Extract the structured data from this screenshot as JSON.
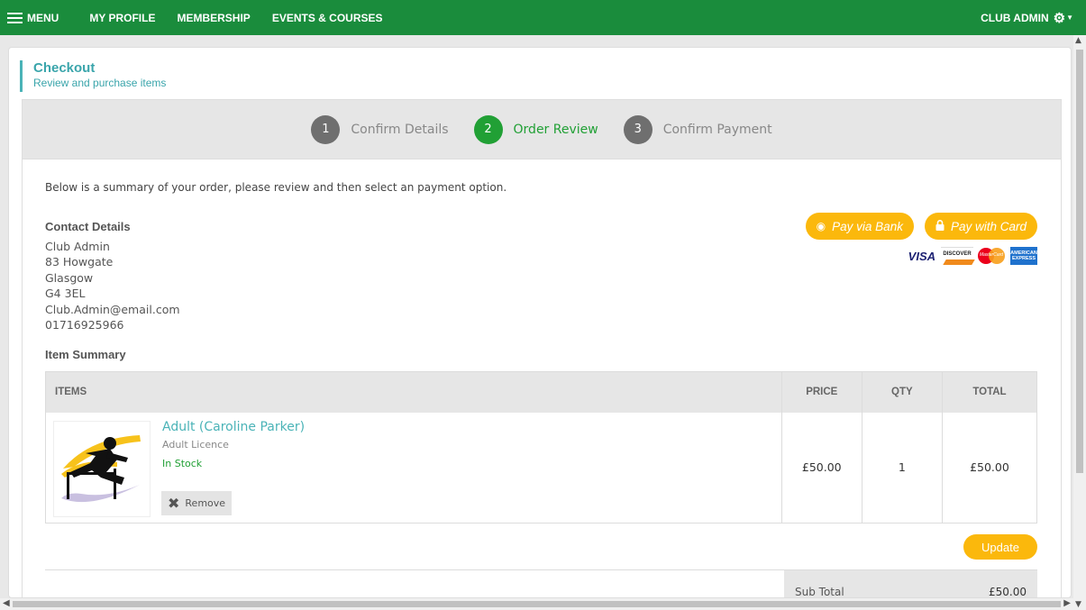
{
  "topbar": {
    "menu_label": "MENU",
    "nav": [
      "MY PROFILE",
      "MEMBERSHIP",
      "EVENTS & COURSES"
    ],
    "user_label": "CLUB ADMIN"
  },
  "page": {
    "title": "Checkout",
    "subtitle": "Review and purchase items"
  },
  "steps": [
    {
      "num": "1",
      "label": "Confirm Details",
      "active": false
    },
    {
      "num": "2",
      "label": "Order Review",
      "active": true
    },
    {
      "num": "3",
      "label": "Confirm Payment",
      "active": false
    }
  ],
  "intro": "Below is a summary of your order, please review and then select an payment option.",
  "contact": {
    "heading": "Contact Details",
    "name": "Club Admin",
    "address1": "83 Howgate",
    "city": "Glasgow",
    "postcode": "G4 3EL",
    "email": "Club.Admin@email.com",
    "phone": "01716925966"
  },
  "payment": {
    "bank_label": "Pay via Bank",
    "card_label": "Pay with Card",
    "cards": {
      "visa": "VISA",
      "discover": "DISCOVER",
      "mastercard": "MasterCard",
      "amex_1": "AMERICAN",
      "amex_2": "EXPRESS"
    }
  },
  "items": {
    "heading": "Item Summary",
    "columns": {
      "items": "ITEMS",
      "price": "PRICE",
      "qty": "QTY",
      "total": "TOTAL"
    },
    "rows": [
      {
        "name": "Adult (Caroline Parker)",
        "type": "Adult Licence",
        "stock": "In Stock",
        "remove_label": "Remove",
        "price": "£50.00",
        "qty": "1",
        "total": "£50.00"
      }
    ]
  },
  "update_label": "Update",
  "subtotal": {
    "label": "Sub Total",
    "value": "£50.00"
  },
  "colors": {
    "brand_green": "#1a8c3c",
    "active_step": "#21a035",
    "accent_teal": "#3aa5ab",
    "button_yellow": "#fbb80c"
  }
}
